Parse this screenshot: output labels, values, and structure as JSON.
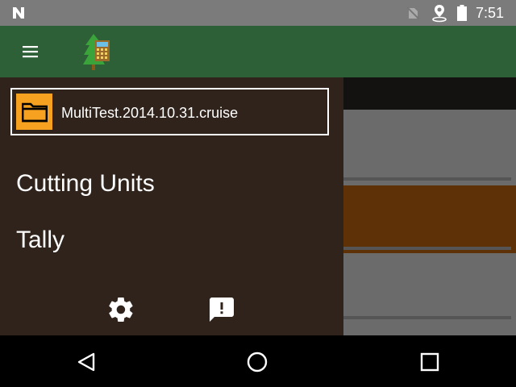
{
  "status_bar": {
    "time": "7:51",
    "icons": [
      "notification-n-icon",
      "no-sim-icon",
      "location-icon",
      "battery-icon"
    ]
  },
  "app_bar": {
    "menu_icon": "hamburger-menu-icon",
    "logo_icon": "tree-cruise-app-logo"
  },
  "drawer": {
    "current_file": "MultiTest.2014.10.31.cruise",
    "file_icon": "folder-icon",
    "items": [
      {
        "label": "Cutting Units"
      },
      {
        "label": "Tally"
      }
    ],
    "actions": [
      "settings-icon",
      "feedback-icon"
    ]
  },
  "colors": {
    "status_bar": "#7b7b7b",
    "app_bar": "#2e6038",
    "drawer": "#30231b",
    "folder_accent": "#f6a11f",
    "selected_row": "#5e3107"
  },
  "nav_bar": {
    "buttons": [
      "back-icon",
      "home-icon",
      "recents-icon"
    ]
  }
}
